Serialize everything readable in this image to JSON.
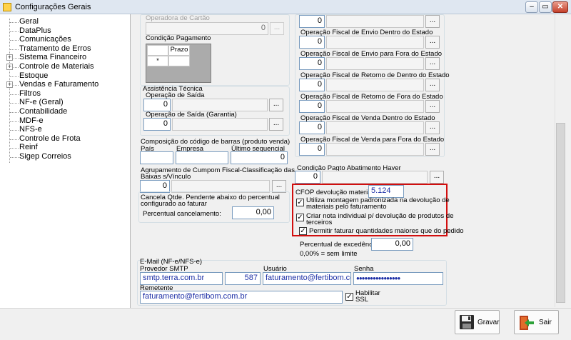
{
  "window": {
    "title": "Configurações Gerais"
  },
  "tree": {
    "items": [
      {
        "label": "Geral",
        "expandable": false
      },
      {
        "label": "DataPlus",
        "expandable": false
      },
      {
        "label": "Comunicações",
        "expandable": false
      },
      {
        "label": "Tratamento de Erros",
        "expandable": false
      },
      {
        "label": "Sistema Financeiro",
        "expandable": true
      },
      {
        "label": "Controle de Materiais",
        "expandable": true
      },
      {
        "label": "Estoque",
        "expandable": false
      },
      {
        "label": "Vendas e Faturamento",
        "expandable": true
      },
      {
        "label": "Filtros",
        "expandable": false
      },
      {
        "label": "NF-e (Geral)",
        "expandable": false
      },
      {
        "label": "Contabilidade",
        "expandable": false
      },
      {
        "label": "MDF-e",
        "expandable": false
      },
      {
        "label": "NFS-e",
        "expandable": false
      },
      {
        "label": "Controle de Frota",
        "expandable": false
      },
      {
        "label": "Reinf",
        "expandable": false
      },
      {
        "label": "Sigep Correios",
        "expandable": false
      }
    ]
  },
  "left": {
    "operadora_cartao_label": "Operadora de Cartão",
    "operadora_cartao_value": "0",
    "condicao_pagamento_label": "Condição Pagamento",
    "grid_col_prazo": "Prazo",
    "grid_new_row_marker": "*",
    "assistencia_label": "Assistência Técnica",
    "op_saida_label": "Operação de Saída",
    "op_saida_value": "0",
    "op_saida_garantia_label": "Operação de Saída (Garantia)",
    "op_saida_garantia_value": "0",
    "barcode_label": "Composição do código de barras (produto venda)",
    "pais_label": "País",
    "empresa_label": "Empresa",
    "ultimo_seq_label": "Último sequencial",
    "ultimo_seq_value": "0",
    "agrupamento_label_1": "Agrupamento de Cumpom Fiscal-Classificação das",
    "agrupamento_label_2": "Baixas s/Vínculo",
    "agrupamento_value": "0",
    "cancela_label_1": "Cancela Qtde. Pendente abaixo do percentual",
    "cancela_label_2": "configurado ao faturar",
    "perc_cancel_label": "Percentual cancelamento:",
    "perc_cancel_value": "0,00"
  },
  "right": {
    "top_value": "0",
    "fiscal_ops": [
      {
        "label": "Operação Fiscal de Envio Dentro do Estado",
        "value": "0"
      },
      {
        "label": "Operação Fiscal de Envio para Fora do Estado",
        "value": "0"
      },
      {
        "label": "Operação Fiscal de Retorno de Dentro do Estado",
        "value": "0"
      },
      {
        "label": "Operação Fiscal de Retorno de Fora do Estado",
        "value": "0"
      },
      {
        "label": "Operação Fiscal de Venda Dentro do Estado",
        "value": "0"
      },
      {
        "label": "Operação Fiscal de Venda para Fora do Estado",
        "value": "0"
      }
    ],
    "cond_abatimento_label": "Condição Pagto Abatimento Haver",
    "cond_abatimento_value": "0",
    "cfop_label": "CFOP devolução materiais:",
    "cfop_value": "5.124",
    "cb1_label_1": "Utiliza montagem padronizada na devolução de",
    "cb1_label_2": "materiais pelo faturamento",
    "cb2_label_1": "Criar nota individual p/ devolução de produtos de",
    "cb2_label_2": "terceiros",
    "cb3_label": "Permitir faturar quantidades maiores que do pedido",
    "perc_exced_label": "Percentual de excedência:",
    "perc_exced_value": "0,00",
    "perc_note": "0,00% = sem limite"
  },
  "email": {
    "group_label": "E-Mail (NF-e/NFS-e)",
    "smtp_label": "Provedor SMTP",
    "smtp_value": "smtp.terra.com.br",
    "port_value": "587",
    "user_label": "Usuário",
    "user_value": "faturamento@fertibom.com.br",
    "pass_label": "Senha",
    "pass_value": "●●●●●●●●●●●●●●●●",
    "remetente_label": "Remetente",
    "remetente_value": "faturamento@fertibom.com.br",
    "ssl_label_1": "Habilitar",
    "ssl_label_2": "SSL"
  },
  "buttons": {
    "save": "Gravar",
    "exit": "Sair",
    "lookup": "..."
  },
  "colors": {
    "highlight_border": "#d20e0e",
    "value_blue": "#1d2fa6"
  }
}
